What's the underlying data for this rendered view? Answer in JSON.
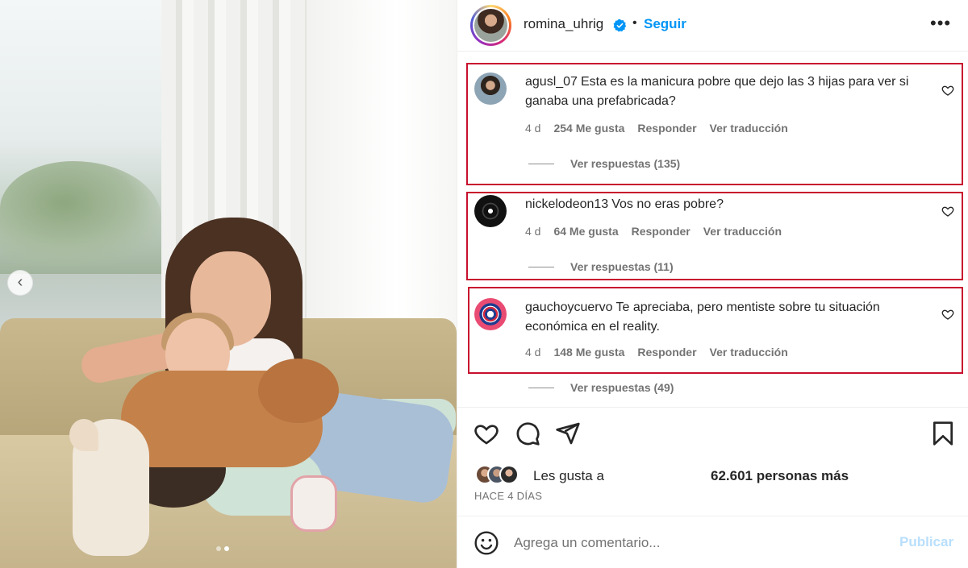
{
  "post": {
    "carousel": {
      "slides": 2,
      "active_slide": 2
    }
  },
  "header": {
    "username": "romina_uhrig",
    "separator": "•",
    "follow_label": "Seguir",
    "more_label": "•••"
  },
  "comments": [
    {
      "user": "agusl_07",
      "text": "Esta es la manicura pobre que dejo las 3 hijas para ver si ganaba una prefabricada?",
      "age": "4 d",
      "likes": "254 Me gusta",
      "reply": "Responder",
      "translate": "Ver traducción",
      "replies": "Ver respuestas (135)"
    },
    {
      "user": "nickelodeon13",
      "text": "Vos no eras pobre?",
      "age": "4 d",
      "likes": "64 Me gusta",
      "reply": "Responder",
      "translate": "Ver traducción",
      "replies": "Ver respuestas (11)"
    },
    {
      "user": "gauchoycuervo",
      "text": "Te apreciaba, pero mentiste sobre tu situación económica en el reality.",
      "age": "4 d",
      "likes": "148 Me gusta",
      "reply": "Responder",
      "translate": "Ver traducción",
      "replies": "Ver respuestas (49)"
    }
  ],
  "actions": {
    "likes_prefix": "Les gusta a",
    "likes_suffix": "62.601 personas más",
    "date": "HACE 4 DÍAS"
  },
  "composer": {
    "placeholder": "Agrega un comentario...",
    "publish_label": "Publicar"
  },
  "colors": {
    "accent": "#0095f6",
    "highlight_box": "#c8102e",
    "muted_text": "#737373",
    "publish_disabled": "#b9dffc"
  },
  "icons": [
    "chevron-left-icon",
    "verified-badge-icon",
    "more-icon",
    "heart-icon",
    "comment-icon",
    "share-icon",
    "bookmark-icon",
    "emoji-icon"
  ]
}
